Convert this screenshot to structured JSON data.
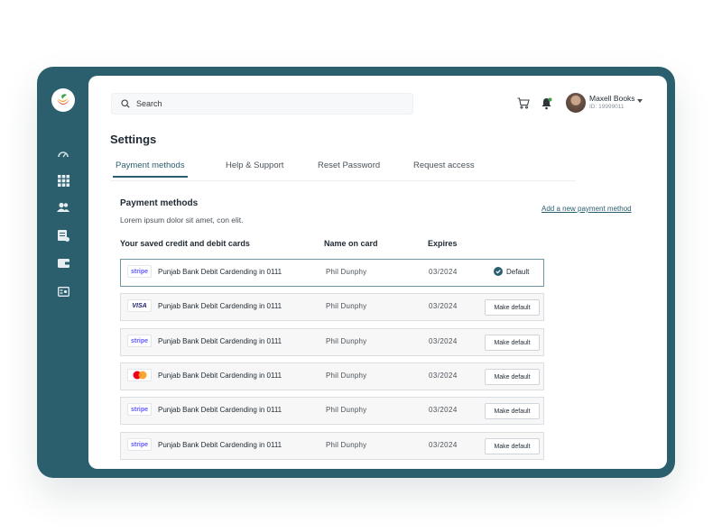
{
  "brand": {
    "accent": "#2b5f6e"
  },
  "sidebar": {
    "items": [
      {
        "icon": "dashboard-gauge-icon"
      },
      {
        "icon": "apps-grid-icon"
      },
      {
        "icon": "users-icon"
      },
      {
        "icon": "billing-icon"
      },
      {
        "icon": "wallet-icon"
      },
      {
        "icon": "id-card-icon"
      }
    ]
  },
  "header": {
    "search_placeholder": "Search",
    "user": {
      "name": "Maxell Books",
      "id": "ID: 19999011"
    }
  },
  "page": {
    "title": "Settings",
    "tabs": [
      {
        "label": "Payment methods",
        "active": true
      },
      {
        "label": "Help & Support",
        "active": false
      },
      {
        "label": "Reset Password",
        "active": false
      },
      {
        "label": "Request access",
        "active": false
      }
    ]
  },
  "payment": {
    "title": "Payment methods",
    "subtitle": "Lorem ipsum dolor sit amet, con  elit.",
    "add_link": "Add a new payment method",
    "columns": {
      "card": "Your saved credit and debit cards",
      "holder": "Name on card",
      "expires": "Expires"
    },
    "default_label": "Default",
    "make_default_label": "Make default",
    "cards": [
      {
        "brand": "stripe",
        "name": "Punjab Bank Debit Cardending in 0111",
        "holder": "Phil Dunphy",
        "expires": "03/2024",
        "is_default": true
      },
      {
        "brand": "visa",
        "name": "Punjab Bank Debit Cardending in 0111",
        "holder": "Phil Dunphy",
        "expires": "03/2024",
        "is_default": false
      },
      {
        "brand": "stripe",
        "name": "Punjab Bank Debit Cardending in 0111",
        "holder": "Phil Dunphy",
        "expires": "03/2024",
        "is_default": false
      },
      {
        "brand": "mastercard",
        "name": "Punjab Bank Debit Cardending in 0111",
        "holder": "Phil Dunphy",
        "expires": "03/2024",
        "is_default": false
      },
      {
        "brand": "stripe",
        "name": "Punjab Bank Debit Cardending in 0111",
        "holder": "Phil Dunphy",
        "expires": "03/2024",
        "is_default": false
      },
      {
        "brand": "stripe",
        "name": "Punjab Bank Debit Cardending in 0111",
        "holder": "Phil Dunphy",
        "expires": "03/2024",
        "is_default": false
      }
    ]
  }
}
